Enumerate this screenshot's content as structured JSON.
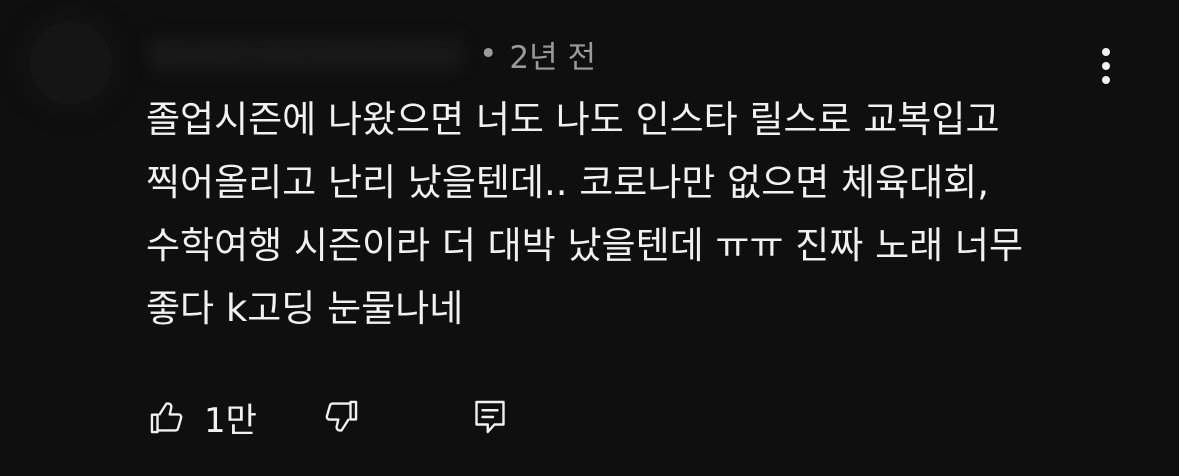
{
  "comment": {
    "author_handle": "@user-w53mz2m4x",
    "separator": "•",
    "time": "2년 전",
    "text": "졸업시즌에 나왔으면 너도 나도 인스타 릴스로 교복입고 찍어올리고 난리 났을텐데.. 코로나만 없으면 체육대회, 수학여행 시즌이라 더 대박 났을텐데 ㅠㅠ 진짜 노래 너무 좋다 k고딩 눈물나네",
    "like_count": "1만"
  },
  "icons": {
    "more": "more-vert-icon",
    "like": "thumb-up-icon",
    "dislike": "thumb-down-icon",
    "reply": "comment-icon"
  },
  "colors": {
    "background": "#0f0f0f",
    "text": "#f1f1f1",
    "secondary_text": "#9a9a9a"
  }
}
